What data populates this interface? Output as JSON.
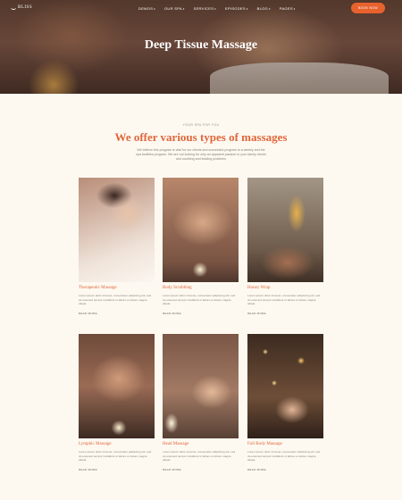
{
  "header": {
    "logo_text": "BLISS",
    "nav": [
      {
        "label": "DEMOS"
      },
      {
        "label": "OUR SPA"
      },
      {
        "label": "SERVICES"
      },
      {
        "label": "EPISODES"
      },
      {
        "label": "BLOG"
      },
      {
        "label": "PAGES"
      }
    ],
    "book_button": "BOOK NOW"
  },
  "hero": {
    "title": "Deep Tissue Massage"
  },
  "section": {
    "subtitle": "YOUR SPA FOR YOU",
    "title": "We offer various types of massages",
    "description": "We believe this program is vital for our clients and successful program to a weekly and the spa facilities program. We are not looking for only an apparent passion to your family clients and soothing and leading problems"
  },
  "cards": [
    {
      "name": "Therapeutic Massage",
      "text": "Lorem ipsum dolor sit amet, consectetur adipiscing elit, sed do eiusmod tempor incididunt ut labore et dolore magna aliqua.",
      "more": "READ MORE"
    },
    {
      "name": "Body Scrubbing",
      "text": "Lorem ipsum dolor sit amet, consectetur adipiscing elit, sed do eiusmod tempor incididunt ut labore et dolore magna aliqua.",
      "more": "READ MORE"
    },
    {
      "name": "Honey Wrap",
      "text": "Lorem ipsum dolor sit amet, consectetur adipiscing elit, sed do eiusmod tempor incididunt ut labore et dolore magna aliqua.",
      "more": "READ MORE"
    },
    {
      "name": "Lymphic Massage",
      "text": "Lorem ipsum dolor sit amet, consectetur adipiscing elit, sed do eiusmod tempor incididunt ut labore et dolore magna aliqua.",
      "more": "READ MORE"
    },
    {
      "name": "Head Massage",
      "text": "Lorem ipsum dolor sit amet, consectetur adipiscing elit, sed do eiusmod tempor incididunt ut labore et dolore magna aliqua.",
      "more": "READ MORE"
    },
    {
      "name": "Full Body Massage",
      "text": "Lorem ipsum dolor sit amet, consectetur adipiscing elit, sed do eiusmod tempor incididunt ut labore et dolore magna aliqua.",
      "more": "READ MORE"
    }
  ],
  "colors": {
    "accent": "#e0663a",
    "button": "#e8622e",
    "background": "#fdf9f1"
  }
}
